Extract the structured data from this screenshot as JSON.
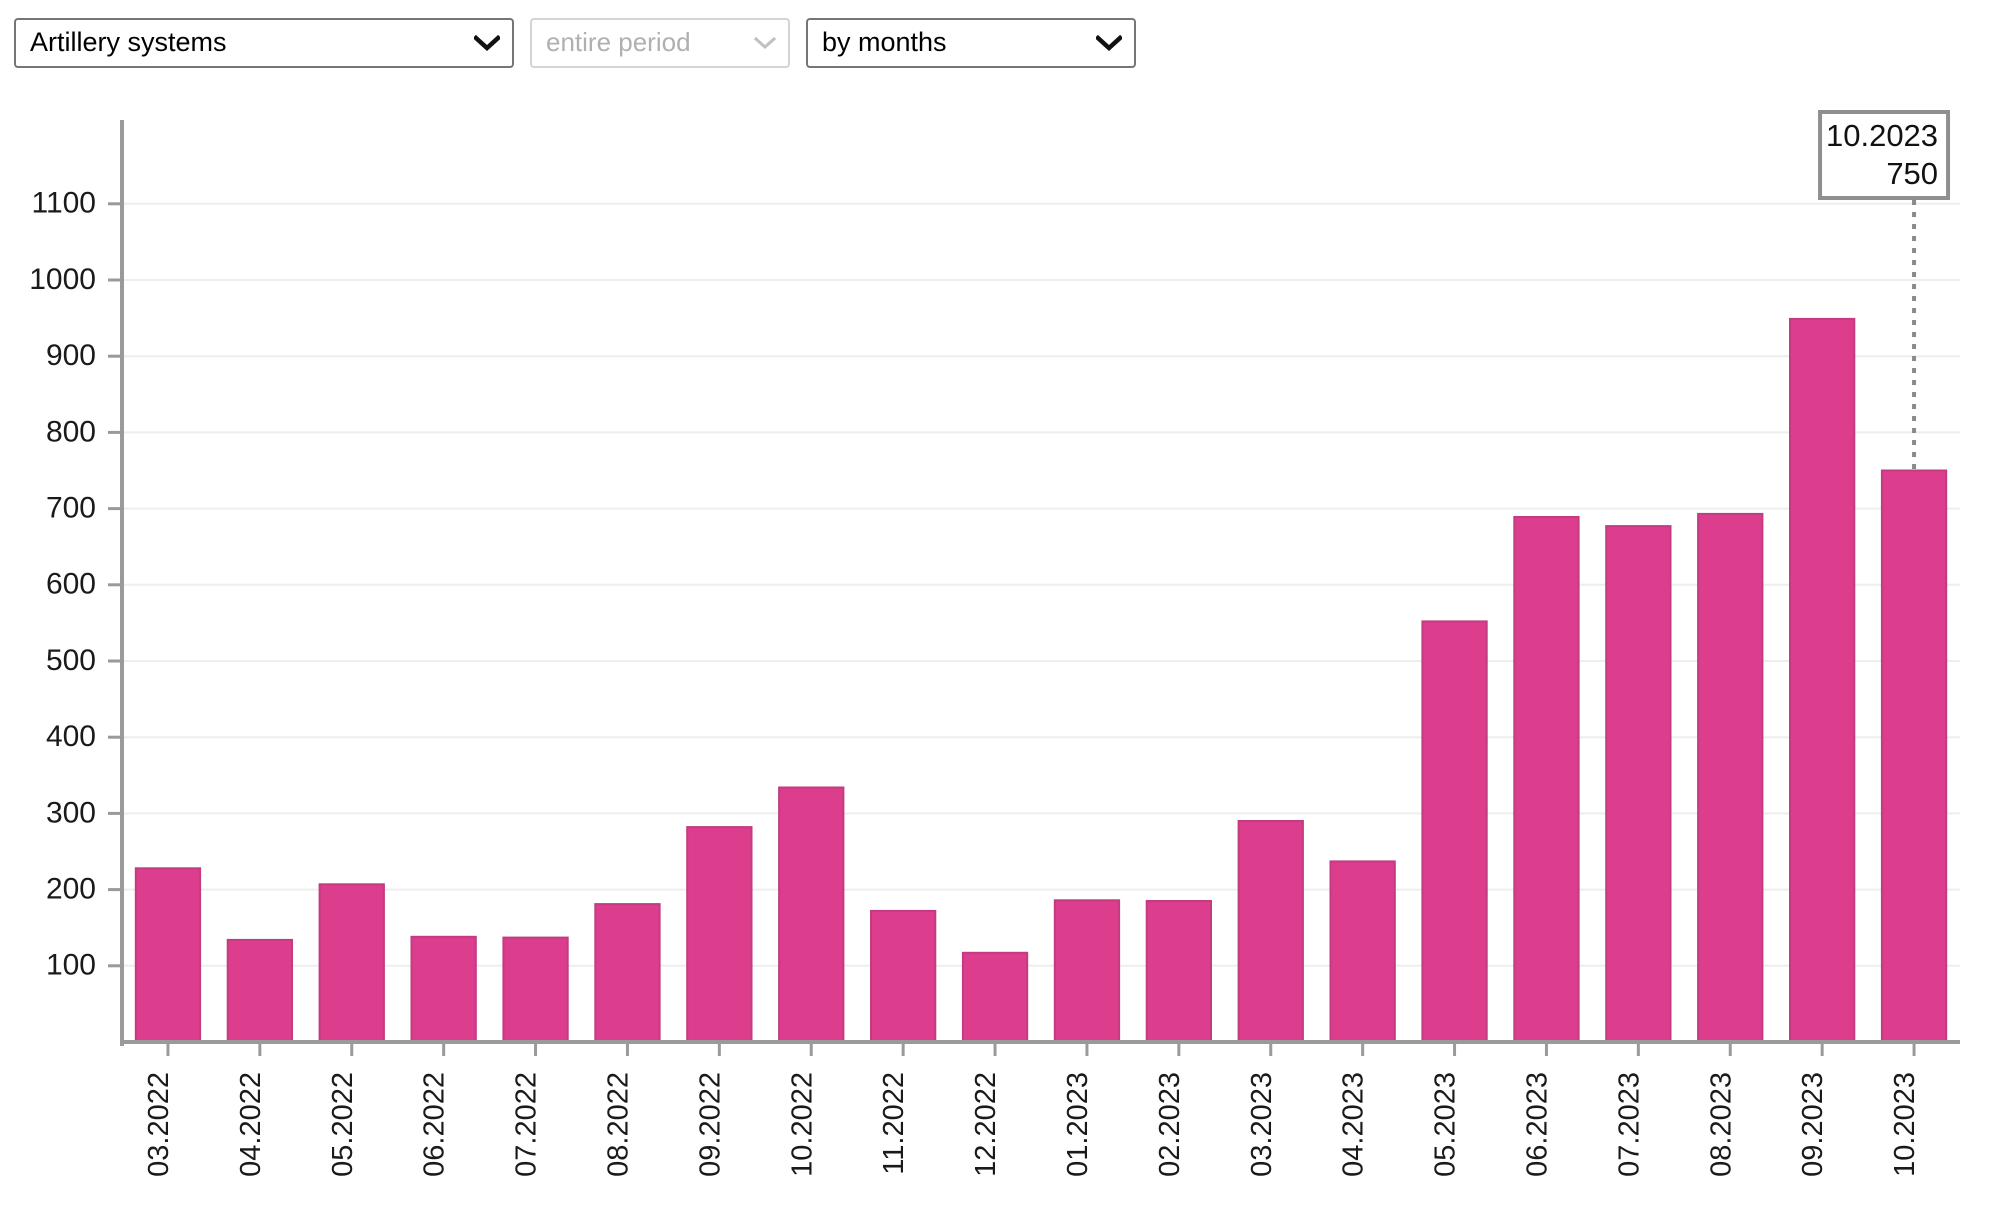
{
  "toolbar": {
    "indicator_select": {
      "value": "Artillery systems",
      "icon": "chevron-down-icon"
    },
    "period_select": {
      "value": "entire period",
      "icon": "chevron-down-icon"
    },
    "granularity_select": {
      "value": "by months",
      "icon": "chevron-down-icon"
    }
  },
  "tooltip": {
    "label": "10.2023",
    "value": "750"
  },
  "colors": {
    "bar_fill": "#dd3d8d",
    "bar_stroke": "#c33b80",
    "grid": "#eeeeee",
    "axis": "#9a9a9a",
    "text": "#1a1a1a"
  },
  "chart_data": {
    "type": "bar",
    "title": "",
    "subtitle": "",
    "xlabel": "",
    "ylabel": "",
    "grid": true,
    "legend": false,
    "ylim": [
      0,
      1150
    ],
    "yticks": [
      100,
      200,
      300,
      400,
      500,
      600,
      700,
      800,
      900,
      1000,
      1100
    ],
    "ytick_labels": [
      "100",
      "200",
      "300",
      "400",
      "500",
      "600",
      "700",
      "800",
      "900",
      "1000",
      "1100"
    ],
    "categories": [
      "03.2022",
      "04.2022",
      "05.2022",
      "06.2022",
      "07.2022",
      "08.2022",
      "09.2022",
      "10.2022",
      "11.2022",
      "12.2022",
      "01.2023",
      "02.2023",
      "03.2023",
      "04.2023",
      "05.2023",
      "06.2023",
      "07.2023",
      "08.2023",
      "09.2023",
      "10.2023"
    ],
    "values": [
      228,
      134,
      207,
      138,
      137,
      181,
      282,
      334,
      172,
      117,
      186,
      185,
      290,
      237,
      552,
      689,
      677,
      693,
      949,
      750
    ],
    "series": [
      {
        "name": "Artillery systems",
        "values": [
          228,
          134,
          207,
          138,
          137,
          181,
          282,
          334,
          172,
          117,
          186,
          185,
          290,
          237,
          552,
          689,
          677,
          693,
          949,
          750
        ]
      }
    ],
    "annotations": [
      {
        "category": "10.2023",
        "label": "10.2023",
        "value": "750"
      }
    ]
  }
}
